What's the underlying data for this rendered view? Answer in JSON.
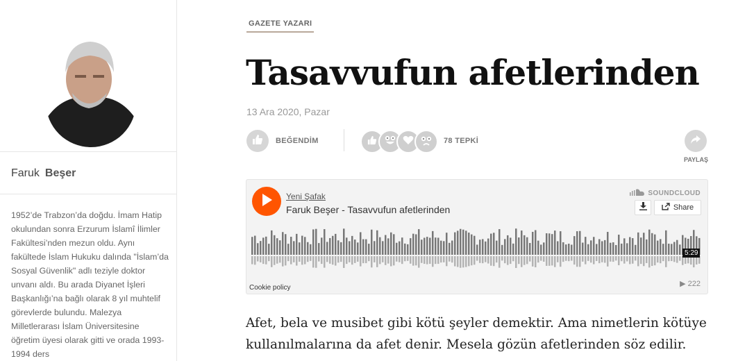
{
  "author": {
    "first_name": "Faruk",
    "last_name": "Beşer",
    "bio": "1952’de Trabzon’da doğdu. İmam Hatip okulundan sonra Erzurum İslamî İlimler Fakültesi’nden mezun oldu. Aynı fakültede İslam Hukuku dalında \"İslam’da Sosyal  Güvenlik\" adlı teziyle doktor unvanı aldı. Bu arada Diyanet İşleri Başkanlığı’na bağlı olarak 8 yıl muhtelif görevlerde bulundu. Malezya Milletlerarası İslam Üniversitesine öğretim üyesi olarak gitti ve orada 1993-1994 ders"
  },
  "article": {
    "kicker": "GAZETE YAZARI",
    "title": "Tasavvufun afetlerinden",
    "date": "13 Ara 2020, Pazar",
    "body": "Afet, bela ve musibet gibi kötü şeyler demektir. Ama nimetlerin kötüye kullanılmalarına da afet denir. Mesela gözün afetlerinden söz edilir."
  },
  "actions": {
    "like_label": "BEĞENDİM",
    "reactions_label": "78 TEPKİ",
    "share_label": "PAYLAŞ"
  },
  "soundcloud": {
    "user": "Yeni Şafak",
    "track": "Faruk Beşer - Tasavvufun afetlerinden",
    "brand": "SOUNDCLOUD",
    "share_label": "Share",
    "duration": "5:29",
    "cookie": "Cookie policy",
    "plays": "222",
    "accent": "#ff5500"
  },
  "icons": [
    "thumb-up-icon",
    "grin-icon",
    "heart-icon",
    "sad-icon",
    "share-arrow-icon",
    "play-icon",
    "download-icon",
    "soundcloud-logo-icon"
  ]
}
